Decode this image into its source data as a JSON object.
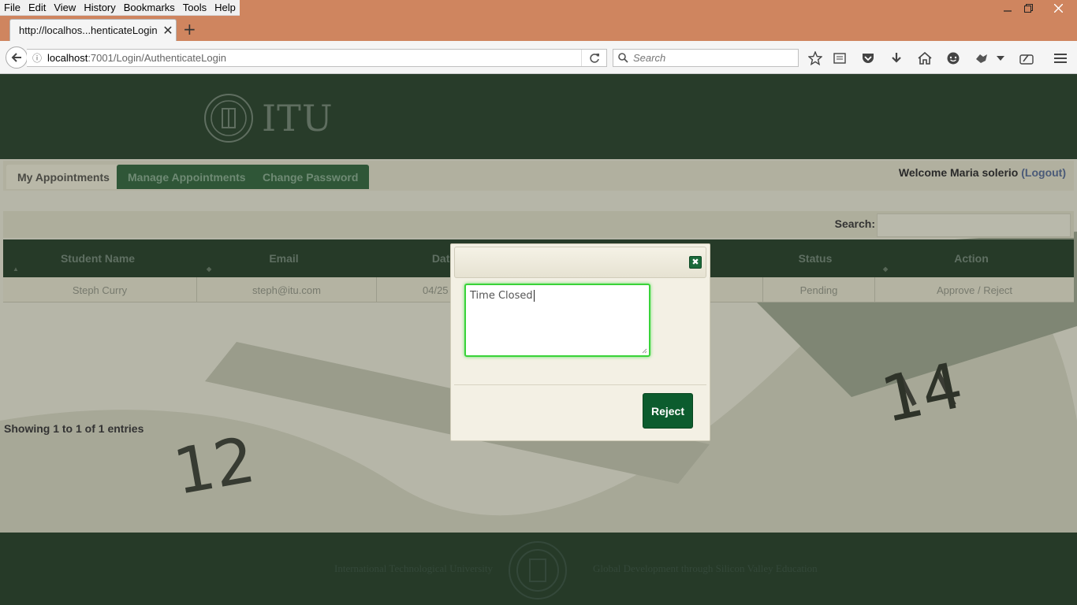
{
  "browser": {
    "menus": [
      "File",
      "Edit",
      "View",
      "History",
      "Bookmarks",
      "Tools",
      "Help"
    ],
    "tab_title": "http://localhos...henticateLogin",
    "url_host": "localhost",
    "url_path": ":7001/Login/AuthenticateLogin",
    "search_placeholder": "Search",
    "colors": {
      "titlebar": "#cf855f",
      "toolbar": "#f5f5f5"
    }
  },
  "site": {
    "logo_text": "ITU",
    "nav_tabs": [
      "My Appointments",
      "Manage Appointments",
      "Change Password"
    ],
    "welcome_text": "Welcome Maria solerio",
    "logout_label": "(Logout)",
    "search_label": "Search:",
    "columns": [
      "Student Name",
      "Email",
      "Date",
      "Status",
      "Action"
    ],
    "rows": [
      {
        "name": "Steph Curry",
        "email": "steph@itu.com",
        "date": "04/25",
        "status": "Pending",
        "action": "Approve / Reject"
      }
    ],
    "showing": "Showing 1 to 1 of 1 entries",
    "footer_left": "International Technological University",
    "footer_right": "Global Development through Silicon Valley Education",
    "colors": {
      "brand_green": "#0c5c2e",
      "header": "#283c2a"
    }
  },
  "modal": {
    "textarea_value": "Time Closed",
    "reject_label": "Reject"
  }
}
